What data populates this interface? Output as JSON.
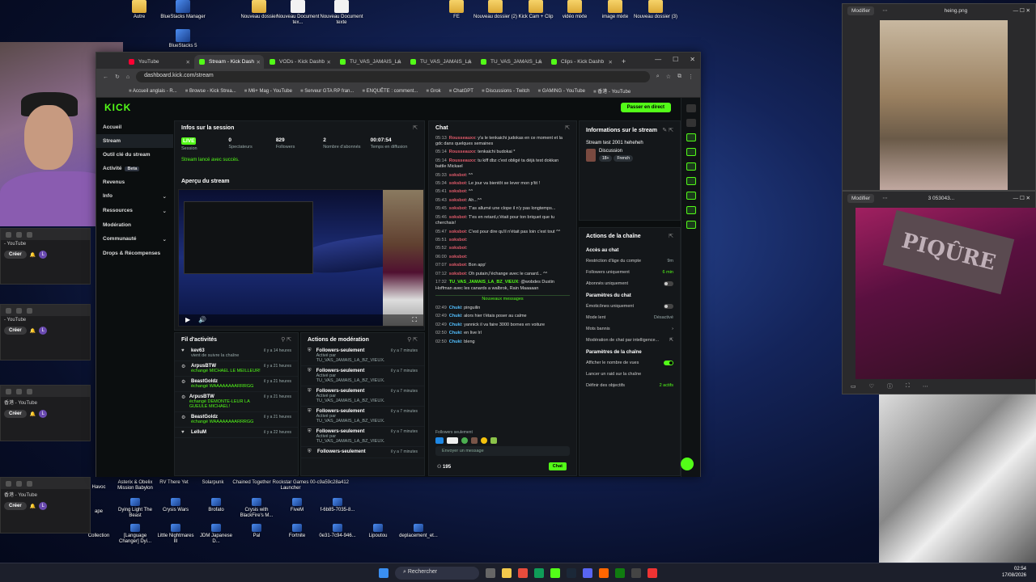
{
  "desktop": {
    "icons_top": [
      {
        "label": "Autre",
        "kind": "folder"
      },
      {
        "label": "BlueStacks Manager",
        "kind": "app"
      },
      {
        "label": "Nouveau dossier",
        "kind": "folder"
      },
      {
        "label": "Nouveau Document tex...",
        "kind": "doc"
      },
      {
        "label": "Nouveau Document texte",
        "kind": "doc"
      },
      {
        "label": "FE",
        "kind": "folder"
      },
      {
        "label": "Nouveau dossier (2)",
        "kind": "folder"
      },
      {
        "label": "Kick Cam + Clip",
        "kind": "folder"
      },
      {
        "label": "vidéo mixte",
        "kind": "folder"
      },
      {
        "label": "image mixte",
        "kind": "folder"
      },
      {
        "label": "Nouveau dossier (3)",
        "kind": "folder"
      }
    ],
    "bluestacks5": "BlueStacks 5",
    "row_bottom_1": [
      "Asterix & Obelix Mission Babylon",
      "RV There Yet",
      "Solarpunk",
      "Chained Together",
      "Rockstar Games Launcher",
      "00-c9a59c28a412"
    ],
    "row_bottom_1_left": [
      "Havoc"
    ],
    "row_bottom_2": [
      "Dying Light The Beast",
      "Crysis Wars",
      "Brofato",
      "Crysis with BlackFire's M...",
      "FiveM",
      "f-6b85-7035-8..."
    ],
    "row_bottom_2_left": [
      "ape"
    ],
    "row_bottom_3": [
      "[Language Changer] Dyi...",
      "Little Nightmares III",
      "JDM Japanese D...",
      "Pal",
      "Fortnite",
      "0e31-7c94-946...",
      "Lipoutou",
      "deplacement_et..."
    ],
    "row_bottom_3_left": [
      "Collection"
    ]
  },
  "left_stack": {
    "windows": [
      {
        "tab": "- YouTube",
        "creer": "Créer",
        "avatar": "L"
      },
      {
        "tab": "- YouTube",
        "creer": "Créer",
        "avatar": "L"
      },
      {
        "tab": "香港 - YouTube",
        "creer": "Créer",
        "avatar": "L"
      },
      {
        "tab": "香港 - YouTube",
        "creer": "Créer",
        "avatar": "L"
      }
    ]
  },
  "browser": {
    "tabs": [
      {
        "label": "YouTube",
        "active": false,
        "kind": "yt"
      },
      {
        "label": "Stream - Kick Dash",
        "active": true,
        "kind": "kick"
      },
      {
        "label": "VODs - Kick Dashb",
        "active": false,
        "kind": "kick"
      },
      {
        "label": "TU_VAS_JAMAIS_LA",
        "active": false,
        "kind": "kick"
      },
      {
        "label": "TU_VAS_JAMAIS_LA",
        "active": false,
        "kind": "kick"
      },
      {
        "label": "TU_VAS_JAMAIS_LA",
        "active": false,
        "kind": "kick"
      },
      {
        "label": "Clips - Kick Dashb",
        "active": false,
        "kind": "kick"
      }
    ],
    "url": "dashboard.kick.com/stream",
    "bookmarks": [
      "Accueil anglais - R...",
      "Browse - Kick Strea...",
      "M6+ Mag - YouTube",
      "Serveur GTA RP fran...",
      "ENQUÊTE : comment...",
      "Grok",
      "ChatGPT",
      "Discussions - Twitch",
      "GAMING - YouTube",
      "香港 - YouTube"
    ]
  },
  "kick": {
    "logo": "KICK",
    "live_button": "Passer en direct",
    "nav": [
      {
        "label": "Accueil",
        "sel": false
      },
      {
        "label": "Stream",
        "sel": true
      },
      {
        "label": "Outil clé du stream",
        "sel": false
      },
      {
        "label": "Activité",
        "sel": false,
        "badge": "Beta"
      },
      {
        "label": "Revenus",
        "sel": false
      },
      {
        "label": "Info",
        "sel": false,
        "caret": true
      },
      {
        "label": "Ressources",
        "sel": false,
        "caret": true
      },
      {
        "label": "Modération",
        "sel": false
      },
      {
        "label": "Communauté",
        "sel": false,
        "caret": true
      },
      {
        "label": "Drops & Récompenses",
        "sel": false
      }
    ],
    "session": {
      "title": "Infos sur la session",
      "stats": [
        {
          "value": "LIVE",
          "label": "Session"
        },
        {
          "value": "0",
          "label": "Spectateurs"
        },
        {
          "value": "829",
          "label": "Followers"
        },
        {
          "value": "2",
          "label": "Nombre d'abonnés"
        },
        {
          "value": "00:07:54",
          "label": "Temps en diffusion"
        }
      ],
      "success": "Stream lancé avec succès.",
      "preview_title": "Aperçu du stream"
    },
    "activity": {
      "title": "Fil d'activités",
      "rows": [
        {
          "name": "kev63",
          "sub": "vient de suivre la chaîne",
          "time": "il y a 14 heures",
          "gray": true
        },
        {
          "name": "ArpusBTW",
          "sub": "échangé MICHAEL LE MEILLEUR!",
          "time": "il y a 21 heures",
          "gray": false
        },
        {
          "name": "BeastGoldz",
          "sub": "échangé WAAAAAAAARRRGG",
          "time": "il y a 21 heures",
          "gray": false
        },
        {
          "name": "ArpusBTW",
          "sub": "échangé DEMONTE-LEUR LA GUEULE MICHAEL!",
          "time": "il y a 21 heures",
          "gray": false
        },
        {
          "name": "BeastGoldz",
          "sub": "échangé WAAAAAAAARRRGG",
          "time": "il y a 21 heures",
          "gray": false
        },
        {
          "name": "LelluM",
          "sub": "",
          "time": "il y a 22 heures",
          "gray": true
        }
      ]
    },
    "moderation": {
      "title": "Actions de modération",
      "rows": [
        {
          "name": "Followers-seulement",
          "sub": "Activé par TU_VAS_JAMAIS_LA_BZ_VIEUX.",
          "time": "il y a 7 minutes"
        },
        {
          "name": "Followers-seulement",
          "sub": "Activé par TU_VAS_JAMAIS_LA_BZ_VIEUX.",
          "time": "il y a 7 minutes"
        },
        {
          "name": "Followers-seulement",
          "sub": "Activé par TU_VAS_JAMAIS_LA_BZ_VIEUX.",
          "time": "il y a 7 minutes"
        },
        {
          "name": "Followers-seulement",
          "sub": "Activé par TU_VAS_JAMAIS_LA_BZ_VIEUX.",
          "time": "il y a 7 minutes"
        },
        {
          "name": "Followers-seulement",
          "sub": "Activé par TU_VAS_JAMAIS_LA_BZ_VIEUX.",
          "time": "il y a 7 minutes"
        },
        {
          "name": "Followers-seulement",
          "sub": "",
          "time": "il y a 7 minutes"
        }
      ]
    },
    "chat": {
      "title": "Chat",
      "lines": [
        {
          "t": "05:13",
          "u": "Rousseauxx",
          "m": "y'a le tenkaichi judokas en ce moment et la gdc dans quelques semaines",
          "c": ""
        },
        {
          "t": "05:14",
          "u": "Rousseauxx",
          "m": "tenkaichi budokai *",
          "c": ""
        },
        {
          "t": "05:14",
          "u": "Rousseauxx",
          "m": "tu kiff dbz c'est obligé ta déjà test dokkan battle Mickael",
          "c": ""
        },
        {
          "t": "05:33",
          "u": "soksbot",
          "m": "^^",
          "c": ""
        },
        {
          "t": "05:34",
          "u": "soksbot",
          "m": "Le jour va bientôt se lever mon p'tit !",
          "c": ""
        },
        {
          "t": "05:41",
          "u": "soksbot",
          "m": "^^",
          "c": ""
        },
        {
          "t": "05:43",
          "u": "soksbot",
          "m": "Ah...^^",
          "c": ""
        },
        {
          "t": "05:45",
          "u": "soksbot",
          "m": "T'as allumé une clope il n'y pas longtemps...",
          "c": ""
        },
        {
          "t": "05:46",
          "u": "soksbot",
          "m": "T'es en retard,c'était pour ton briquet que tu cherchais!",
          "c": ""
        },
        {
          "t": "05:47",
          "u": "soksbot",
          "m": "C'est pour dire qu'il n'était pas loin c'est tout ^^",
          "c": ""
        },
        {
          "t": "05:51",
          "u": "soksbot",
          "m": "",
          "c": ""
        },
        {
          "t": "05:52",
          "u": "soksbot",
          "m": "",
          "c": ""
        },
        {
          "t": "06:00",
          "u": "soksbot",
          "m": "",
          "c": ""
        },
        {
          "t": "07:07",
          "u": "soksbot",
          "m": "Bon app'",
          "c": ""
        },
        {
          "t": "07:12",
          "u": "soksbot",
          "m": "Oh putain,l'échange avec le canard... ^^",
          "c": ""
        },
        {
          "t": "17:32",
          "u": "TU_VAS_JAMAIS_LA_BZ_VIEUX",
          "m": "@wobdes Dustin Hoffman avec les canards a walbrok, Rain Maaaaan",
          "c": "gr"
        }
      ],
      "separator": "Nouveaux messages",
      "new_lines": [
        {
          "t": "02:49",
          "u": "Chuki",
          "m": "pinguilin",
          "c": "cy"
        },
        {
          "t": "02:49",
          "u": "Chuki",
          "m": "alors hier t'étais poser au calme",
          "c": "cy"
        },
        {
          "t": "02:49",
          "u": "Chuki",
          "m": "yannick il va faire 3000 bornes en voiture",
          "c": "cy"
        },
        {
          "t": "02:50",
          "u": "Chuki",
          "m": "en live lrl",
          "c": "cy"
        },
        {
          "t": "02:50",
          "u": "Chuki",
          "m": "bleng",
          "c": "cy"
        }
      ],
      "followers_only": "Followers seulement",
      "placeholder": "Envoyer un message",
      "viewers": "195",
      "send": "Chat"
    },
    "stream_info": {
      "title": "Informations sur le stream",
      "stream_title": "Stream test 2001 heheheh",
      "category": "Discussion",
      "tags": [
        "18+",
        "French"
      ]
    },
    "channel_actions": {
      "title": "Actions de la chaîne",
      "chat_access": "Accès au chat",
      "rows1": [
        {
          "label": "Restriction d'âge du compte",
          "val": "9m",
          "type": "val"
        },
        {
          "label": "Followers uniquement",
          "val": "6 min",
          "type": "valgr"
        },
        {
          "label": "Abonnés uniquement",
          "val": "",
          "type": "tog"
        }
      ],
      "chat_params": "Paramètres du chat",
      "rows2": [
        {
          "label": "Émoticônes uniquement",
          "val": "",
          "type": "tog"
        },
        {
          "label": "Mode lent",
          "val": "Désactivé",
          "type": "val"
        },
        {
          "label": "Mots bannis",
          "val": "",
          "type": "arrow"
        },
        {
          "label": "Modération de chat par intelligence...",
          "val": "",
          "type": "ext"
        }
      ],
      "channel_params": "Paramètres de la chaîne",
      "rows3": [
        {
          "label": "Afficher le nombre de vues",
          "val": "",
          "type": "togon"
        },
        {
          "label": "Lancer un raid sur la chaîne",
          "val": "",
          "type": "none"
        },
        {
          "label": "Définir des objectifs",
          "val": "2 actifs",
          "type": "valgr"
        }
      ]
    }
  },
  "right_windows": {
    "top": {
      "button": "Modifier",
      "title": "heing.png"
    },
    "mid": {
      "button": "Modifier",
      "title": "3 053043...",
      "sign_text": "PIQÛRE"
    }
  },
  "taskbar": {
    "search": "Rechercher",
    "time": "02:54",
    "date": "17/08/2026"
  }
}
